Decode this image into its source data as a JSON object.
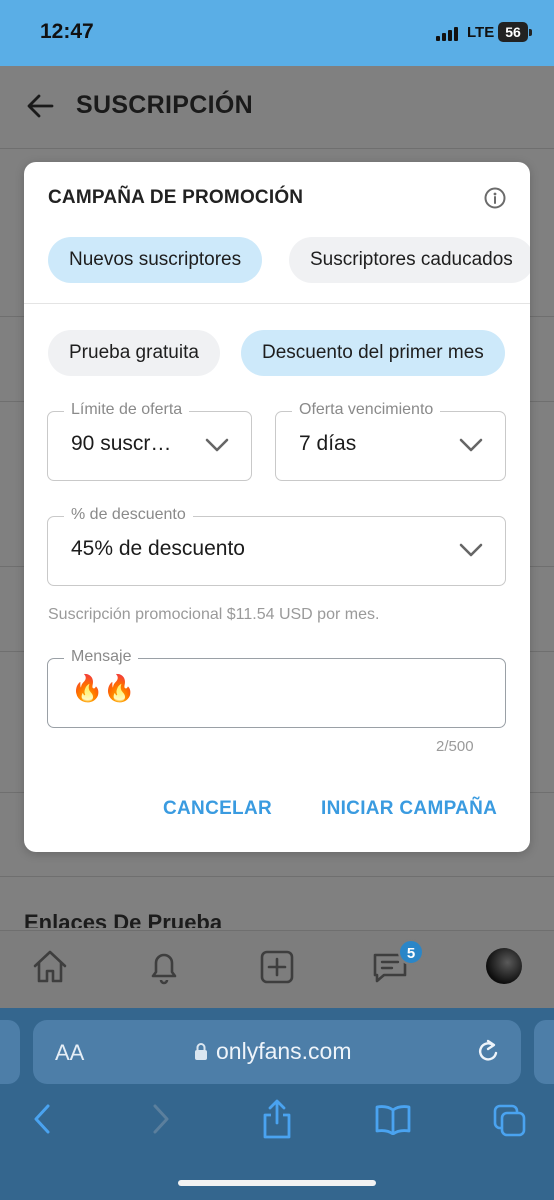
{
  "status_bar": {
    "time": "12:47",
    "network": "LTE",
    "battery": "56"
  },
  "app": {
    "title": "SUSCRIPCIÓN",
    "section_peek": "Enlaces De Prueba",
    "messages_badge": "5"
  },
  "modal": {
    "title": "CAMPAÑA DE PROMOCIÓN",
    "audience_tabs": [
      {
        "label": "Nuevos suscriptores",
        "active": true
      },
      {
        "label": "Suscriptores caducados",
        "active": false
      }
    ],
    "type_tabs": [
      {
        "label": "Prueba gratuita",
        "active": false
      },
      {
        "label": "Descuento del primer mes",
        "active": true
      }
    ],
    "offer_limit": {
      "label": "Límite de oferta",
      "value": "90 suscr…"
    },
    "offer_expiration": {
      "label": "Oferta vencimiento",
      "value": "7 días"
    },
    "discount": {
      "label": "% de descuento",
      "value": "45% de descuento"
    },
    "helper_text": "Suscripción promocional $11.54 USD por mes.",
    "message": {
      "label": "Mensaje",
      "value": "🔥🔥"
    },
    "char_counter": "2/500",
    "cancel_label": "CANCELAR",
    "start_label": "INICIAR CAMPAÑA"
  },
  "browser": {
    "text_size_label": "AA",
    "url": "onlyfans.com"
  }
}
